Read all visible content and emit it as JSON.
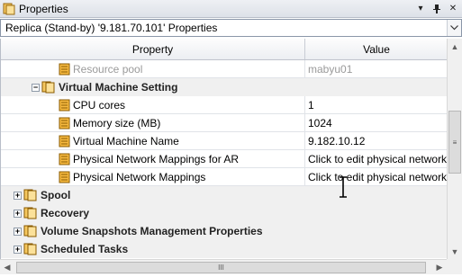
{
  "titlebar": {
    "title": "Properties",
    "dropdown_glyph": "▾",
    "pin_glyph": "ᵖ",
    "close_glyph": "✕"
  },
  "selector": {
    "value": "Replica (Stand-by)  '9.181.70.101' Properties",
    "arrow": "⌄"
  },
  "grid": {
    "headers": {
      "property": "Property",
      "value": "Value"
    },
    "rows": [
      {
        "kind": "prop",
        "label": "Resource pool",
        "value": "mabyu01",
        "disabled": true
      },
      {
        "kind": "cat",
        "label": "Virtual Machine Setting",
        "expander": "−"
      },
      {
        "kind": "prop",
        "label": "CPU cores",
        "value": "1"
      },
      {
        "kind": "prop",
        "label": "Memory size (MB)",
        "value": "1024"
      },
      {
        "kind": "prop",
        "label": "Virtual Machine Name",
        "value": "9.182.10.12"
      },
      {
        "kind": "prop",
        "label": "Physical Network Mappings for AR",
        "value": "Click to edit physical network"
      },
      {
        "kind": "prop",
        "label": "Physical Network Mappings",
        "value": "Click to edit physical network"
      },
      {
        "kind": "cat",
        "label": "Spool",
        "expander": "+"
      },
      {
        "kind": "cat",
        "label": "Recovery",
        "expander": "+"
      },
      {
        "kind": "cat",
        "label": "Volume Snapshots Management Properties",
        "expander": "+"
      },
      {
        "kind": "cat",
        "label": "Scheduled Tasks",
        "expander": "+"
      }
    ]
  },
  "scrollbars": {
    "up": "▲",
    "down": "▼",
    "left": "◀",
    "right": "▶",
    "v_grip": "≡",
    "h_grip": "III"
  },
  "colors": {
    "icon_orange": "#f0a020",
    "icon_dark": "#8a5a00",
    "disabled_text": "#9a9a9a",
    "category_bg": "#f0f0f0"
  }
}
